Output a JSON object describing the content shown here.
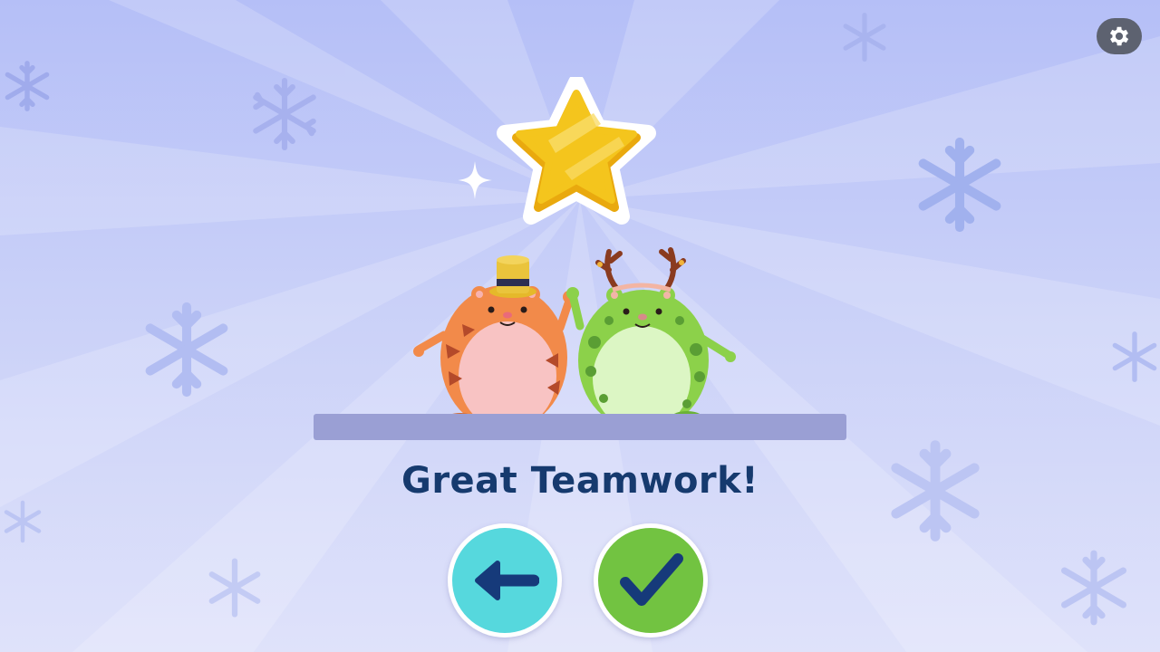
{
  "screen": {
    "message": "Great Teamwork!"
  },
  "buttons": {
    "back_icon": "arrow-left-icon",
    "confirm_icon": "checkmark-icon",
    "settings_icon": "gear-icon"
  },
  "reward": {
    "icon": "gold-star-icon"
  },
  "characters": [
    {
      "name": "tiger-character",
      "accessory": "gold-top-hat"
    },
    {
      "name": "green-monster-character",
      "accessory": "reindeer-antlers"
    }
  ],
  "colors": {
    "title": "#163a6e",
    "back_button": "#56d8dd",
    "confirm_button": "#72c341",
    "star": "#f2c21c",
    "shelf": "#9a9fd4"
  }
}
